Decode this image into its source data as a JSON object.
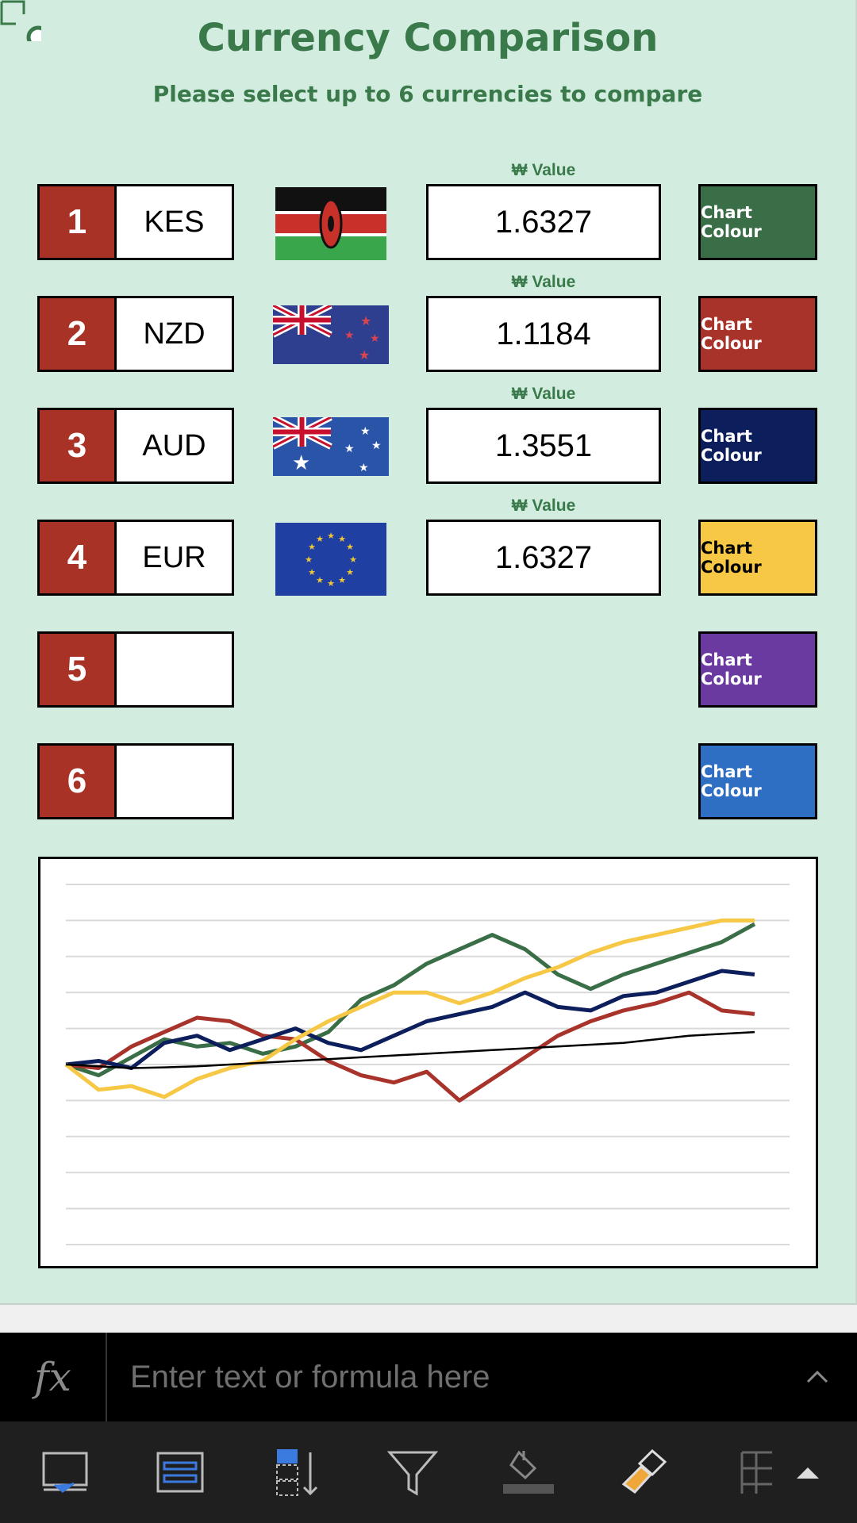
{
  "sheet": {
    "title": "Currency Comparison",
    "subtitle": "Please select up to 6 currencies to compare",
    "value_label": "₩ Value",
    "colour_label": "Chart Colour",
    "rows": [
      {
        "num": "1",
        "code": "KES",
        "value": "1.6327",
        "flag": "kenya",
        "colour": "#3a6e47"
      },
      {
        "num": "2",
        "code": "NZD",
        "value": "1.1184",
        "flag": "new-zealand",
        "colour": "#a8332a"
      },
      {
        "num": "3",
        "code": "AUD",
        "value": "1.3551",
        "flag": "australia",
        "colour": "#0c1f5c"
      },
      {
        "num": "4",
        "code": "EUR",
        "value": "1.6327",
        "flag": "eu",
        "colour": "#f6c845"
      },
      {
        "num": "5",
        "code": "",
        "value": "",
        "flag": "",
        "colour": "#6a3aa0"
      },
      {
        "num": "6",
        "code": "",
        "value": "",
        "flag": "",
        "colour": "#2f6fc3"
      }
    ]
  },
  "chart_data": {
    "type": "line",
    "gridlines": 10,
    "ylim": [
      0,
      10
    ],
    "series": [
      {
        "color": "#3a6e47",
        "values": [
          5,
          4.7,
          5.2,
          5.7,
          5.5,
          5.6,
          5.3,
          5.5,
          5.9,
          6.8,
          7.2,
          7.8,
          8.2,
          8.6,
          8.2,
          7.5,
          7.1,
          7.5,
          7.8,
          8.1,
          8.4,
          8.9
        ]
      },
      {
        "color": "#a8332a",
        "values": [
          5,
          4.9,
          5.5,
          5.9,
          6.3,
          6.2,
          5.8,
          5.7,
          5.1,
          4.7,
          4.5,
          4.8,
          4.0,
          4.6,
          5.2,
          5.8,
          6.2,
          6.5,
          6.7,
          7.0,
          6.5,
          6.4
        ]
      },
      {
        "color": "#0c1f5c",
        "values": [
          5,
          5.1,
          4.9,
          5.6,
          5.8,
          5.4,
          5.7,
          6.0,
          5.6,
          5.4,
          5.8,
          6.2,
          6.4,
          6.6,
          7.0,
          6.6,
          6.5,
          6.9,
          7.0,
          7.3,
          7.6,
          7.5
        ]
      },
      {
        "color": "#f6c845",
        "values": [
          5,
          4.3,
          4.4,
          4.1,
          4.6,
          4.9,
          5.1,
          5.7,
          6.2,
          6.6,
          7.0,
          7.0,
          6.7,
          7.0,
          7.4,
          7.7,
          8.1,
          8.4,
          8.6,
          8.8,
          9.0,
          9.0
        ]
      },
      {
        "color": "#000000",
        "values": [
          5,
          4.95,
          4.9,
          4.92,
          4.95,
          5.0,
          5.05,
          5.1,
          5.15,
          5.2,
          5.25,
          5.3,
          5.35,
          5.4,
          5.45,
          5.5,
          5.55,
          5.6,
          5.7,
          5.8,
          5.85,
          5.9
        ]
      }
    ]
  },
  "formula_bar": {
    "fx_label": "fx",
    "placeholder": "Enter text or formula here"
  },
  "toolbar": {
    "icons": [
      "freeze-panes-icon",
      "format-table-icon",
      "sort-icon",
      "filter-icon",
      "fill-color-icon",
      "format-painter-icon",
      "insert-cells-icon",
      "expand-up-icon"
    ]
  }
}
